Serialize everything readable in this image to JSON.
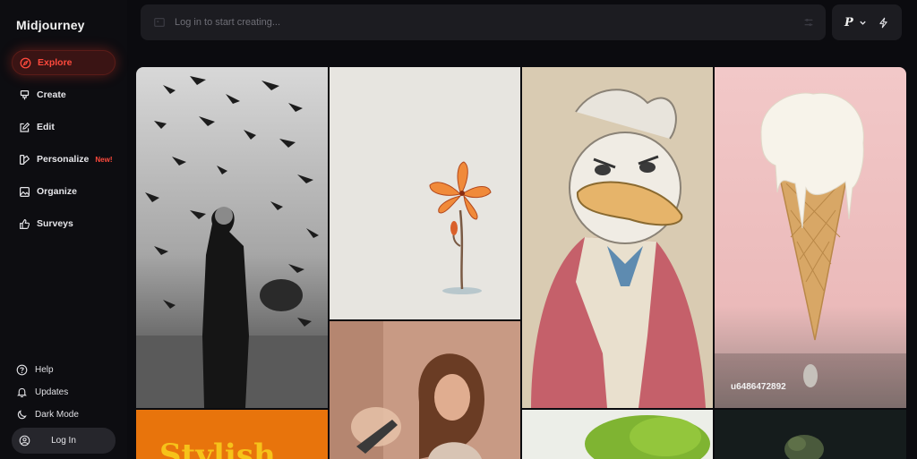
{
  "app": {
    "name": "Midjourney"
  },
  "sidebar": {
    "items": [
      {
        "label": "Explore",
        "icon": "compass-icon",
        "active": true
      },
      {
        "label": "Create",
        "icon": "brush-icon"
      },
      {
        "label": "Edit",
        "icon": "edit-icon"
      },
      {
        "label": "Personalize",
        "icon": "palette-icon",
        "badge": "New!"
      },
      {
        "label": "Organize",
        "icon": "image-icon"
      },
      {
        "label": "Surveys",
        "icon": "thumbs-up-icon"
      }
    ],
    "bottom": [
      {
        "label": "Help",
        "icon": "help-icon"
      },
      {
        "label": "Updates",
        "icon": "bell-icon"
      },
      {
        "label": "Dark Mode",
        "icon": "moon-icon"
      }
    ],
    "login_label": "Log In"
  },
  "prompt": {
    "placeholder": "Log in to start creating..."
  },
  "mode": {
    "profile": "P"
  },
  "gallery": {
    "tiles": [
      {
        "subject": "pigeons-man-bw"
      },
      {
        "subject": "orange-lily-drawing"
      },
      {
        "subject": "duck-in-coat-sketch"
      },
      {
        "subject": "ice-cream-cone",
        "caption": "u6486472892"
      },
      {
        "subject": "portrait-girl"
      },
      {
        "subject": "orange-stylish-poster",
        "text": "Stylish"
      },
      {
        "subject": "green-tree"
      },
      {
        "subject": "dark-bush"
      }
    ]
  },
  "colors": {
    "accent": "#ff4a3d",
    "background": "#0b0b0f",
    "panel": "#1c1c21"
  }
}
